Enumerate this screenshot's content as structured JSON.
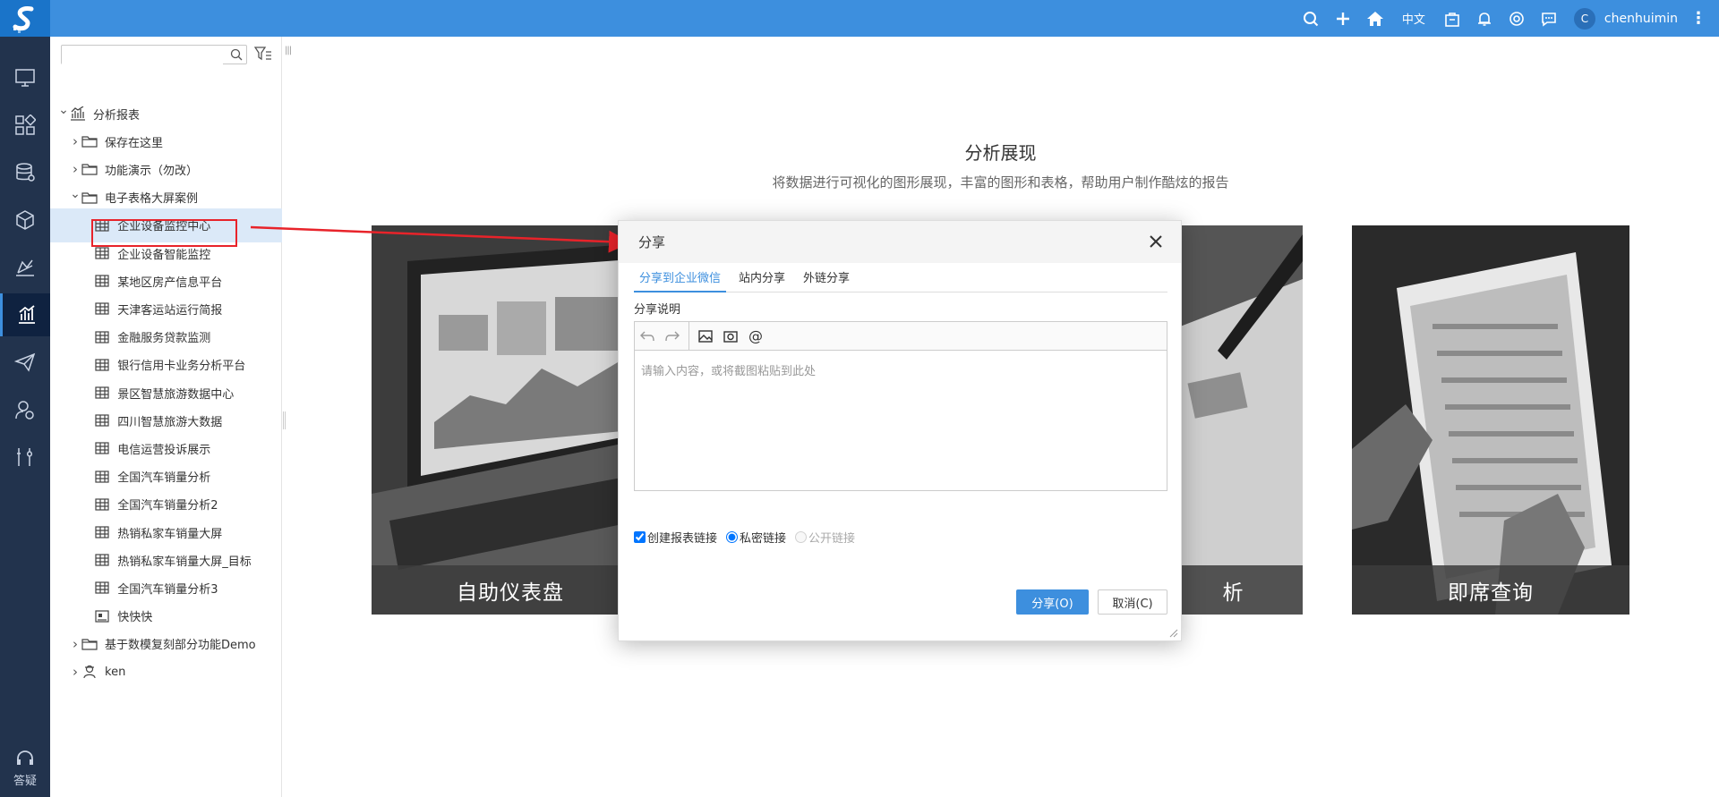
{
  "header": {
    "lang": "中文",
    "avatar_letter": "C",
    "username": "chenhuimin",
    "icons": [
      "search-icon",
      "plus-icon",
      "home-icon",
      "bag-icon",
      "bell-icon",
      "theme-icon",
      "message-icon"
    ],
    "bar_color": "#3d8fde"
  },
  "rail": {
    "help_label": "答疑",
    "items": [
      "monitor-icon",
      "layout-icon",
      "database-icon",
      "cube-icon",
      "chart-area-icon",
      "report-icon",
      "send-icon",
      "user-settings-icon",
      "tools-icon"
    ],
    "active_index": 5,
    "bg_color": "#22334d"
  },
  "tree": {
    "search_placeholder": "",
    "root": "分析报表",
    "items": [
      {
        "label": "保存在这里",
        "type": "folder",
        "level": 1,
        "expanded": false
      },
      {
        "label": "功能演示（勿改）",
        "type": "folder",
        "level": 1,
        "expanded": false
      },
      {
        "label": "电子表格大屏案例",
        "type": "folder",
        "level": 1,
        "expanded": true
      },
      {
        "label": "企业设备监控中心",
        "type": "table",
        "level": 2,
        "selected": true
      },
      {
        "label": "企业设备智能监控",
        "type": "table",
        "level": 2
      },
      {
        "label": "某地区房产信息平台",
        "type": "table",
        "level": 2
      },
      {
        "label": "天津客运站运行简报",
        "type": "table",
        "level": 2
      },
      {
        "label": "金融服务贷款监测",
        "type": "table",
        "level": 2
      },
      {
        "label": "银行信用卡业务分析平台",
        "type": "table",
        "level": 2
      },
      {
        "label": "景区智慧旅游数据中心",
        "type": "table",
        "level": 2
      },
      {
        "label": "四川智慧旅游大数据",
        "type": "table",
        "level": 2
      },
      {
        "label": "电信运营投诉展示",
        "type": "table",
        "level": 2
      },
      {
        "label": "全国汽车销量分析",
        "type": "table",
        "level": 2
      },
      {
        "label": "全国汽车销量分析2",
        "type": "table",
        "level": 2
      },
      {
        "label": "热销私家车销量大屏",
        "type": "table",
        "level": 2
      },
      {
        "label": "热销私家车销量大屏_目标",
        "type": "table",
        "level": 2
      },
      {
        "label": "全国汽车销量分析3",
        "type": "table",
        "level": 2
      },
      {
        "label": "快快快",
        "type": "image",
        "level": 2
      },
      {
        "label": "基于数模复刻部分功能Demo",
        "type": "folder",
        "level": 1,
        "expanded": false
      },
      {
        "label": "ken",
        "type": "user",
        "level": 1,
        "expanded": false
      }
    ]
  },
  "main": {
    "title": "分析展现",
    "subtitle": "将数据进行可视化的图形展现，丰富的图形和表格，帮助用户制作酷炫的报告",
    "cards": [
      {
        "caption": "自助仪表盘"
      },
      {
        "caption": "析"
      },
      {
        "caption": "即席查询"
      }
    ]
  },
  "dialog": {
    "title": "分享",
    "tabs": [
      {
        "label": "分享到企业微信",
        "active": true
      },
      {
        "label": "站内分享",
        "active": false
      },
      {
        "label": "外链分享",
        "active": false
      }
    ],
    "desc_label": "分享说明",
    "editor_placeholder": "请输入内容，或将截图粘贴到此处",
    "toolbar": [
      "undo-icon",
      "redo-icon",
      "image-icon",
      "screenshot-icon",
      "at-icon"
    ],
    "options": {
      "create_link": {
        "label": "创建报表链接",
        "checked": true
      },
      "private_link": {
        "label": "私密链接",
        "checked": true
      },
      "public_link": {
        "label": "公开链接",
        "checked": false,
        "disabled": true
      }
    },
    "share_button": "分享(O)",
    "cancel_button": "取消(C)"
  },
  "annotation_color": "#e8232a"
}
